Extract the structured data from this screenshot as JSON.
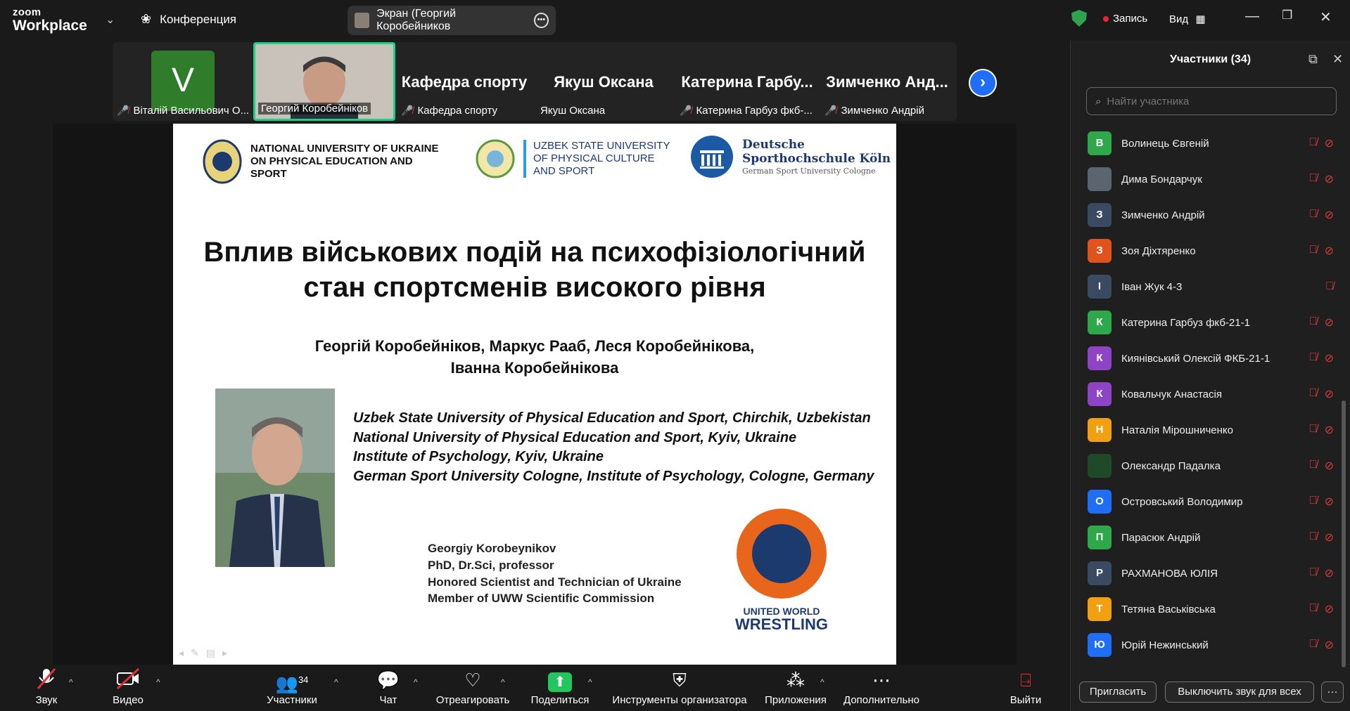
{
  "app": {
    "logo_top": "zoom",
    "logo_bottom": "Workplace",
    "meeting_label": "Конференция"
  },
  "share_pill": {
    "label": "Экран (Георгий Коробейников"
  },
  "top_right": {
    "record_label": "Запись",
    "view_label": "Вид"
  },
  "gallery": {
    "tiles": [
      {
        "label": "Віталій Васильович О...",
        "avatar_letter": "V",
        "avatar_color": "#2f7d2b"
      },
      {
        "label": "Георгий Коробейніков"
      },
      {
        "label": "Кафедра спорту",
        "big": "Кафедра спорту"
      },
      {
        "label": "Якуш Оксана",
        "big": "Якуш Оксана"
      },
      {
        "label": "Катерина Гарбуз фкб-...",
        "big": "Катерина Гарбу..."
      },
      {
        "label": "Зимченко Андрій",
        "big": "Зимченко Анд..."
      }
    ]
  },
  "slide": {
    "uni1": [
      "NATIONAL UNIVERSITY OF UKRAINE",
      "ON PHYSICAL EDUCATION AND",
      "SPORT"
    ],
    "uni2": [
      "UZBEK STATE UNIVERSITY",
      "OF PHYSICAL CULTURE",
      "AND SPORT"
    ],
    "uni3": [
      "Deutsche",
      "Sporthochschule Köln",
      "German Sport University Cologne"
    ],
    "title_line1": "Вплив військових подій на психофізіологічний",
    "title_line2": "стан спортсменів високого рівня",
    "authors_line1": "Георгій Коробейніков, Маркус Рааб, Леся Коробейнікова,",
    "authors_line2": "Іванна Коробейнікова",
    "affiliations": [
      "Uzbek State University of Physical Education and Sport, Chirchik, Uzbekistan",
      "National University of Physical Education and Sport, Kyiv, Ukraine",
      "Institute of Psychology, Kyiv, Ukraine",
      "German Sport University Cologne, Institute of Psychology, Cologne, Germany"
    ],
    "info": [
      "Georgiy Korobeynikov",
      "PhD, Dr.Sci, professor",
      "Honored Scientist and Technician of Ukraine",
      "Member of UWW Scientific Commission"
    ],
    "uww_line1": "UNITED WORLD",
    "uww_line2": "WRESTLING"
  },
  "participants": {
    "title": "Участники (34)",
    "search_placeholder": "Найти участника",
    "list": [
      {
        "letter": "В",
        "name": "Волинець Євгеній",
        "color": "#2ea84a",
        "video_off": true
      },
      {
        "letter": "",
        "name": "Дима Бондарчук",
        "color": "#5b6570",
        "video_off": true
      },
      {
        "letter": "З",
        "name": "Зимченко Андрій",
        "color": "#3a4a63",
        "video_off": true
      },
      {
        "letter": "З",
        "name": "Зоя Діхтяренко",
        "color": "#e0531c",
        "video_off": true
      },
      {
        "letter": "І",
        "name": "Іван Жук 4-3",
        "color": "#3a4a63",
        "video_off": false
      },
      {
        "letter": "К",
        "name": "Катерина Гарбуз фкб-21-1",
        "color": "#2ea84a",
        "video_off": true
      },
      {
        "letter": "К",
        "name": "Киянівський Олексій ФКБ-21-1",
        "color": "#8e44c4",
        "video_off": true
      },
      {
        "letter": "К",
        "name": "Ковальчук Анастасія",
        "color": "#8e44c4",
        "video_off": true
      },
      {
        "letter": "Н",
        "name": "Наталія Мірошниченко",
        "color": "#f0a010",
        "video_off": true
      },
      {
        "letter": "",
        "name": "Олександр Падалка",
        "color": "#1e4a2a",
        "video_off": true
      },
      {
        "letter": "О",
        "name": "Островський Володимир",
        "color": "#1f6ef5",
        "video_off": true
      },
      {
        "letter": "П",
        "name": "Парасюк Андрій",
        "color": "#2ea84a",
        "video_off": true
      },
      {
        "letter": "Р",
        "name": "РАХМАНОВА ЮЛІЯ",
        "color": "#3a4a63",
        "video_off": true
      },
      {
        "letter": "Т",
        "name": "Тетяна Васьківська",
        "color": "#f0a010",
        "video_off": true
      },
      {
        "letter": "Ю",
        "name": "Юрій Нежинський",
        "color": "#1f6ef5",
        "video_off": true
      }
    ],
    "invite_label": "Пригласить",
    "mute_all_label": "Выключить звук для всех",
    "more_label": "···"
  },
  "toolbar": {
    "audio": "Звук",
    "video": "Видео",
    "participants": "Участники",
    "participants_count": "34",
    "chat": "Чат",
    "react": "Отреагировать",
    "share": "Поделиться",
    "host_tools": "Инструменты организатора",
    "apps": "Приложения",
    "more": "Дополнительно",
    "leave": "Выйти"
  }
}
